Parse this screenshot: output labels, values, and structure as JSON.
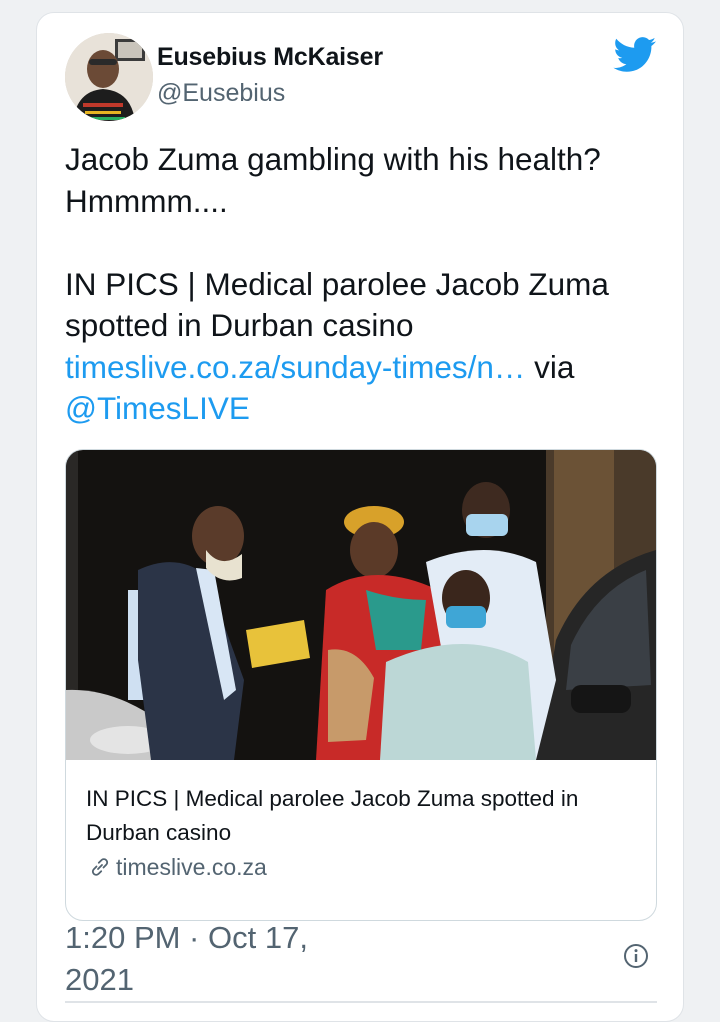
{
  "author": {
    "name": "Eusebius McKaiser",
    "handle": "@Eusebius"
  },
  "tweet": {
    "line1": "Jacob Zuma gambling with his health? Hmmmm....",
    "line2_text": "IN PICS | Medical parolee Jacob Zuma spotted in Durban casino",
    "link_text": "timeslive.co.za/sunday-times/n…",
    "via_text": " via ",
    "mention": "@TimesLIVE"
  },
  "link_card": {
    "title": "IN PICS | Medical parolee Jacob Zuma spotted in Durban casino",
    "domain": "timeslive.co.za"
  },
  "meta": {
    "timestamp": "1:20 PM · Oct 17, 2021"
  },
  "icons": {
    "platform_logo": "twitter-bird-icon",
    "link": "link-icon",
    "info": "info-icon"
  },
  "colors": {
    "accent": "#1d9bf0",
    "text": "#0f1419",
    "muted": "#536471",
    "border": "#cfd9de"
  }
}
